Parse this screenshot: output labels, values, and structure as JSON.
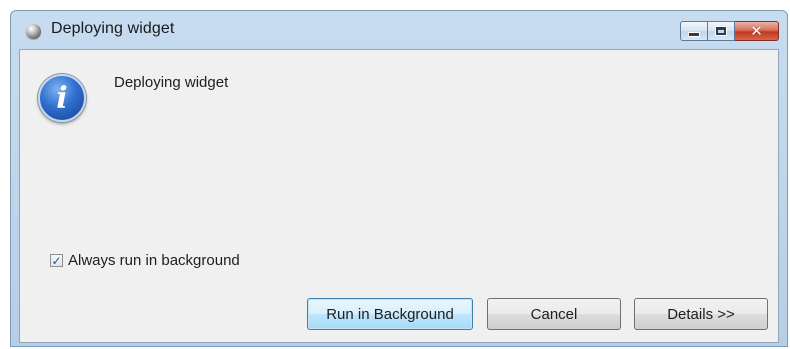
{
  "window": {
    "title": "Deploying widget",
    "app_icon": "window-orb-icon",
    "controls": {
      "minimize_icon": "minimize-icon",
      "maximize_icon": "maximize-icon",
      "close_glyph": "✕"
    }
  },
  "dialog": {
    "icon": "info-icon",
    "icon_glyph": "i",
    "message": "Deploying widget",
    "checkbox": {
      "label": "Always run in background",
      "checked": true
    },
    "buttons": {
      "run_in_background": "Run in Background",
      "cancel": "Cancel",
      "details": "Details >>"
    }
  },
  "colors": {
    "frame": "#b6cfe6",
    "client_bg": "#f0f0f0",
    "default_button_border": "#3c7fb1",
    "close_button": "#c0391f",
    "info_icon_blue": "#2f6fd0"
  }
}
